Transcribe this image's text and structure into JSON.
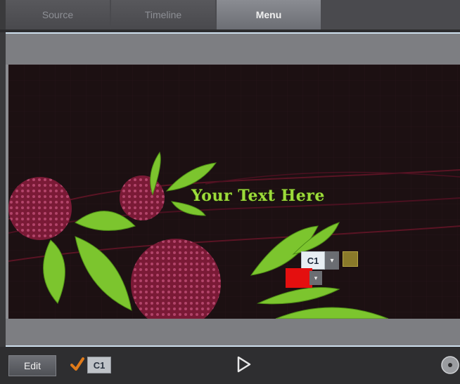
{
  "tabs": [
    {
      "label": "Source"
    },
    {
      "label": "Timeline"
    },
    {
      "label": "Menu",
      "active": true
    }
  ],
  "menu_preview": {
    "text_label": "Your Text Here",
    "chapter_button_label": "C1",
    "dropdown_glyph": "▾"
  },
  "toolbar": {
    "edit_label": "Edit",
    "chapter_toggle_label": "C1",
    "show_chapter_checked": true
  },
  "icons": {
    "check": "check-icon",
    "play": "play-icon",
    "disc": "disc-icon"
  },
  "colors": {
    "accent_green": "#9ddc3a",
    "flower": "#8a1d3c",
    "marker_red": "#e40f0f",
    "check_orange": "#e07b1a"
  }
}
